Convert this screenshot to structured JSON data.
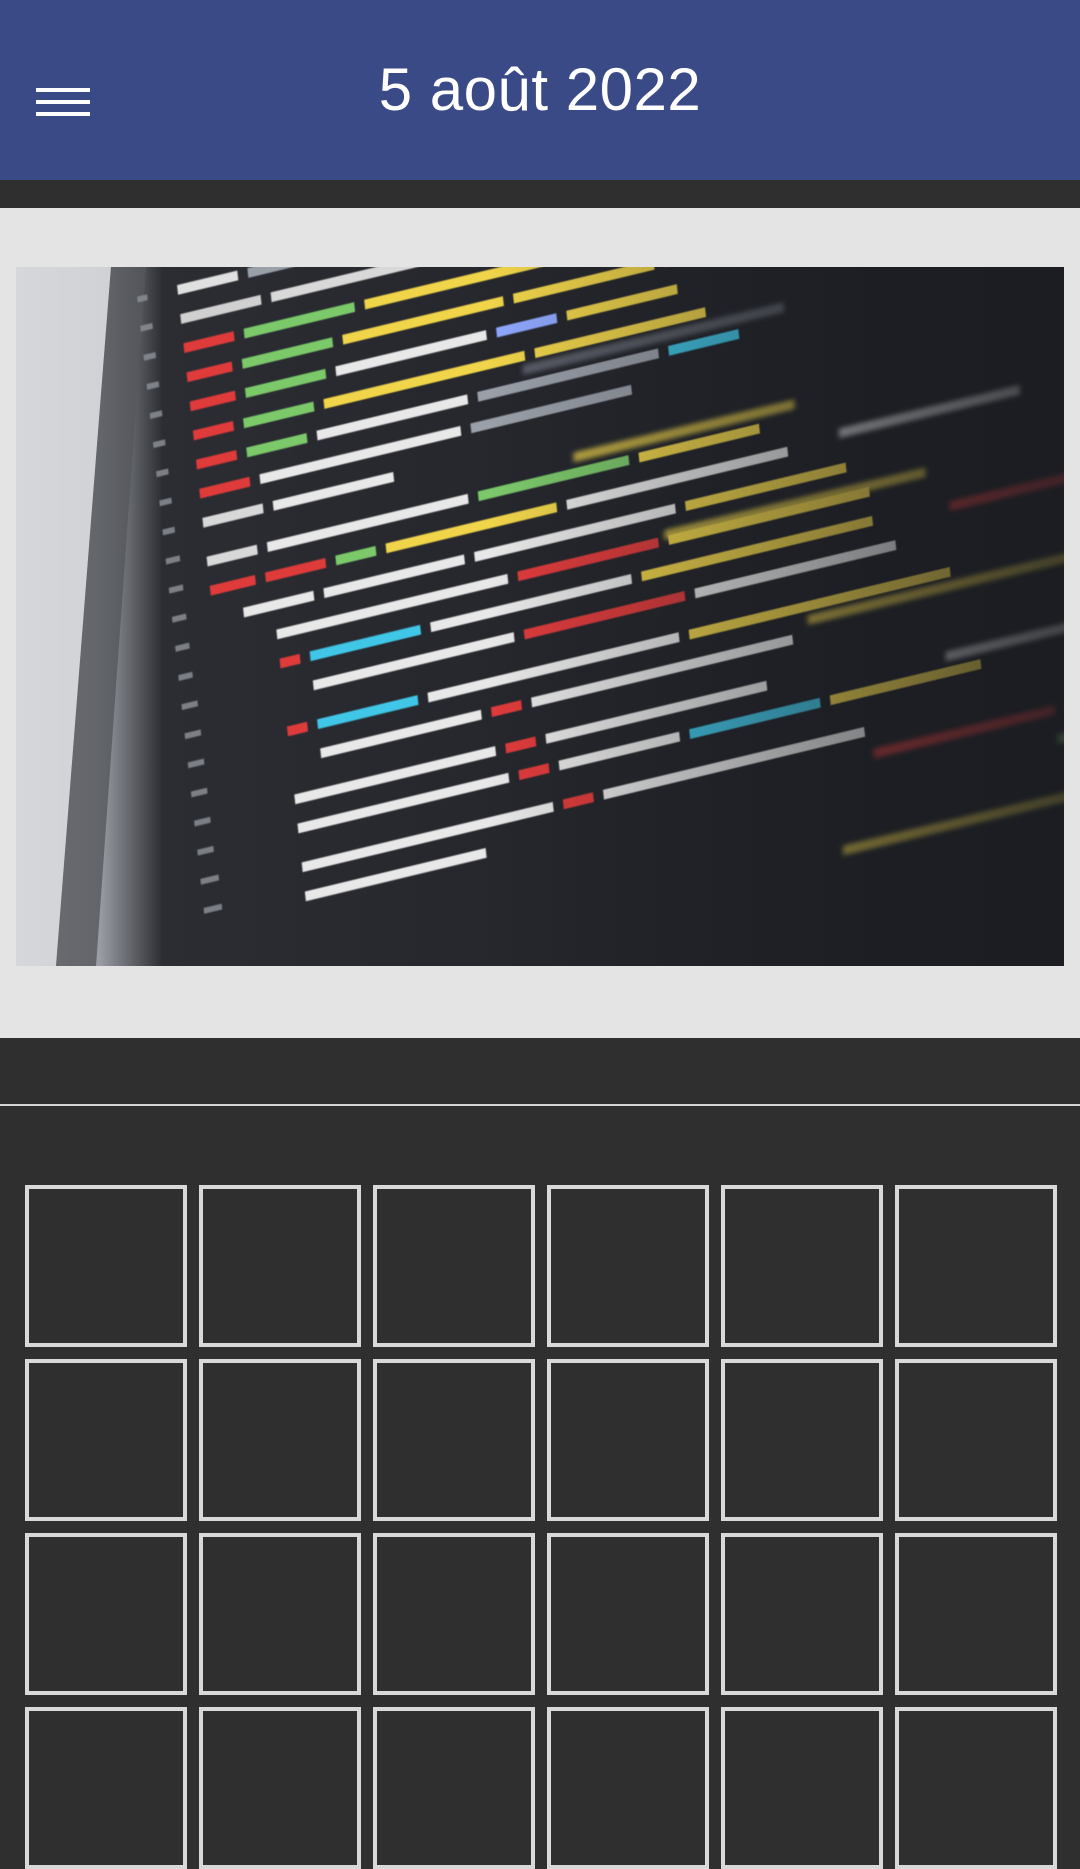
{
  "header": {
    "title": "5 août 2022",
    "menu_icon": "hamburger-menu-icon",
    "background_color": "#3a4a86"
  },
  "featured": {
    "image_subject": "code-editor-photo",
    "panel_color": "#e4e4e4"
  },
  "grid": {
    "columns": 6,
    "rows_visible": 4,
    "tile_border_color": "#d9d9d9",
    "page_background": "#2f2f2f"
  }
}
